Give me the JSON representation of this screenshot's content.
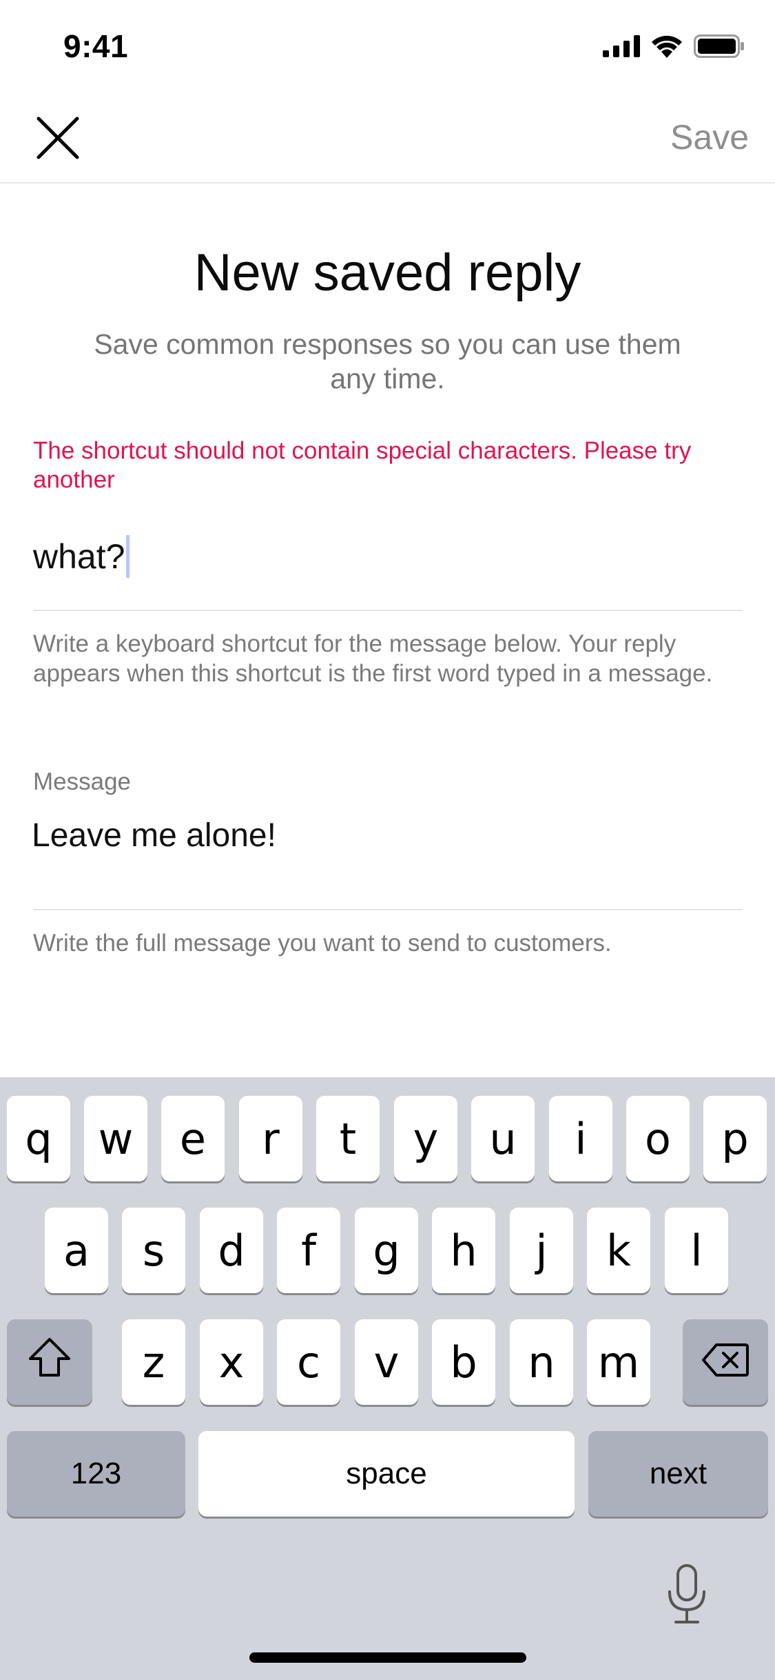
{
  "status_bar": {
    "time": "9:41",
    "icons": [
      "cellular-signal-icon",
      "wifi-icon",
      "battery-icon"
    ]
  },
  "nav": {
    "close_icon": "close-icon",
    "save_label": "Save"
  },
  "page": {
    "title": "New saved reply",
    "subtitle": "Save common responses so you can use them any time."
  },
  "shortcut": {
    "error": "The shortcut should not contain special characters. Please try another",
    "value": "what?",
    "help": "Write a keyboard shortcut for the message below. Your reply appears when this shortcut is the first word typed in a message."
  },
  "message": {
    "label": "Message",
    "value": "Leave me alone!",
    "help": "Write the full message you want to send to customers."
  },
  "keyboard": {
    "row1": [
      "q",
      "w",
      "e",
      "r",
      "t",
      "y",
      "u",
      "i",
      "o",
      "p"
    ],
    "row2": [
      "a",
      "s",
      "d",
      "f",
      "g",
      "h",
      "j",
      "k",
      "l"
    ],
    "row3": [
      "z",
      "x",
      "c",
      "v",
      "b",
      "n",
      "m"
    ],
    "numbers_label": "123",
    "space_label": "space",
    "next_label": "next",
    "icons": [
      "shift-icon",
      "backspace-icon",
      "microphone-icon"
    ]
  },
  "colors": {
    "error": "#e3134f",
    "secondary_text": "#7a7a7a",
    "caret": "#b9c6ff",
    "keyboard_bg": "#d1d4db"
  }
}
